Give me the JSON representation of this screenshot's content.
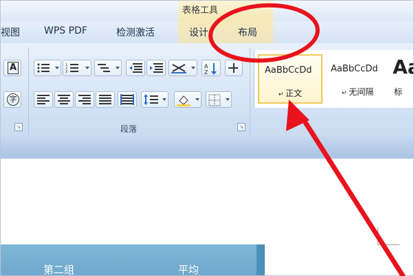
{
  "context": {
    "title": "表格工具"
  },
  "tabs": [
    {
      "label": "视图"
    },
    {
      "label": "WPS PDF"
    },
    {
      "label": "检测激活"
    },
    {
      "label": "设计"
    },
    {
      "label": "布局"
    }
  ],
  "ribbon": {
    "paragraph_group_label": "段落",
    "font_group_buttons": {
      "a_label": "A",
      "zi_label": "字"
    }
  },
  "styles": [
    {
      "sample": "AaBbCcDd",
      "name": "正文",
      "selected": true
    },
    {
      "sample": "AaBbCcDd",
      "name": "无间隔",
      "selected": false
    },
    {
      "sample": "Aa",
      "name": "标",
      "selected": false
    }
  ],
  "table": {
    "cell1": "第二组",
    "cell2": "平均"
  },
  "colors": {
    "annotation": "#e8131d",
    "selected_style_border": "#f0c75b",
    "table_header": "#74aed2"
  }
}
